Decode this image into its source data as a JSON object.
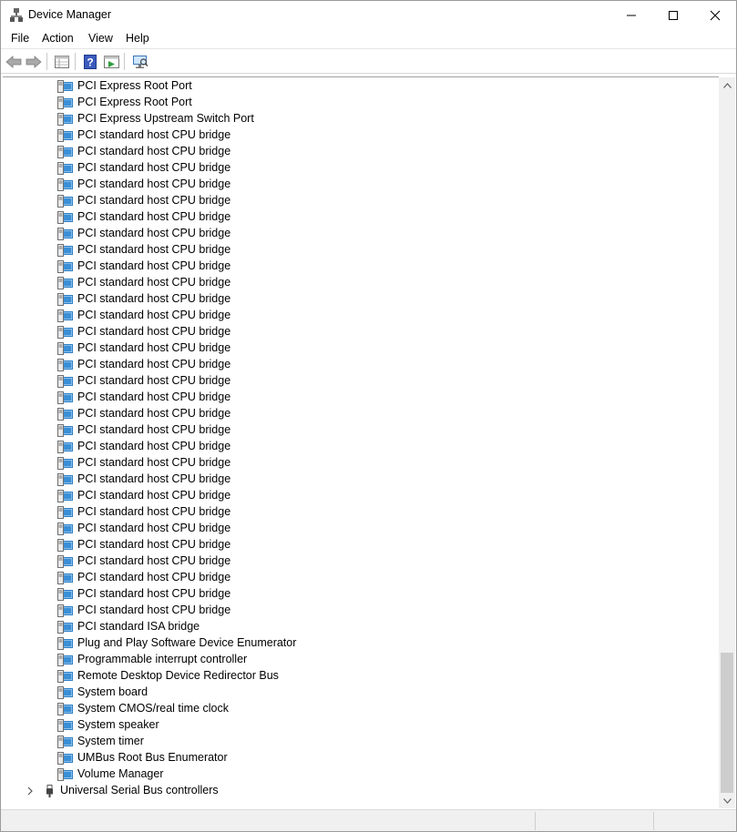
{
  "window": {
    "title": "Device Manager"
  },
  "menu": {
    "file": "File",
    "action": "Action",
    "view": "View",
    "help": "Help"
  },
  "toolbar": {
    "icons": [
      "back-arrow-icon",
      "forward-arrow-icon",
      "properties-grid-icon",
      "help-icon",
      "update-driver-icon",
      "scan-hardware-icon"
    ]
  },
  "tree": {
    "devices": [
      "PCI Express Root Port",
      "PCI Express Root Port",
      "PCI Express Upstream Switch Port",
      "PCI standard host CPU bridge",
      "PCI standard host CPU bridge",
      "PCI standard host CPU bridge",
      "PCI standard host CPU bridge",
      "PCI standard host CPU bridge",
      "PCI standard host CPU bridge",
      "PCI standard host CPU bridge",
      "PCI standard host CPU bridge",
      "PCI standard host CPU bridge",
      "PCI standard host CPU bridge",
      "PCI standard host CPU bridge",
      "PCI standard host CPU bridge",
      "PCI standard host CPU bridge",
      "PCI standard host CPU bridge",
      "PCI standard host CPU bridge",
      "PCI standard host CPU bridge",
      "PCI standard host CPU bridge",
      "PCI standard host CPU bridge",
      "PCI standard host CPU bridge",
      "PCI standard host CPU bridge",
      "PCI standard host CPU bridge",
      "PCI standard host CPU bridge",
      "PCI standard host CPU bridge",
      "PCI standard host CPU bridge",
      "PCI standard host CPU bridge",
      "PCI standard host CPU bridge",
      "PCI standard host CPU bridge",
      "PCI standard host CPU bridge",
      "PCI standard host CPU bridge",
      "PCI standard host CPU bridge",
      "PCI standard ISA bridge",
      "Plug and Play Software Device Enumerator",
      "Programmable interrupt controller",
      "Remote Desktop Device Redirector Bus",
      "System board",
      "System CMOS/real time clock",
      "System speaker",
      "System timer",
      "UMBus Root Bus Enumerator",
      "Volume Manager"
    ],
    "category": {
      "label": "Universal Serial Bus controllers",
      "icon": "usb-icon",
      "expanded": false
    }
  },
  "colors": {
    "device_icon": "#3b8fd6",
    "scroll_thumb": "#cdcdcd"
  }
}
